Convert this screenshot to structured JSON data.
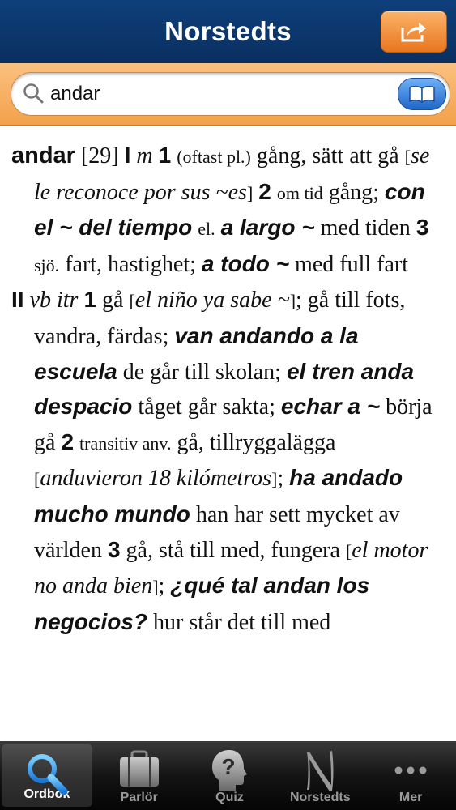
{
  "header": {
    "title": "Norstedts",
    "share_icon": "share-icon"
  },
  "search": {
    "value": "andar",
    "icon": "search-icon",
    "book_icon": "book-icon"
  },
  "entry": {
    "headword": "andar",
    "conj": "[29]",
    "s1": "I",
    "pos1": "m",
    "n1": "1",
    "note1": "(oftast pl.)",
    "t1": "gång, sätt att gå",
    "ex1": "se le reconoce por sus ~es",
    "n2": "2",
    "note2": "om tid",
    "t2": "gång;",
    "ex2a": "con el ~ del tiempo",
    "el": "el.",
    "ex2b": "a largo ~",
    "t3": "med tiden",
    "n3": "3",
    "note3": "sjö.",
    "t4": "fart, hastighet;",
    "ex3": "a todo ~",
    "t5": "med full fart",
    "s2": "II",
    "pos2": "vb itr",
    "m1": "1",
    "t6": "gå",
    "ex4": "el niño ya sabe ~",
    "t7": "; gå till fots, vandra, färdas;",
    "ex5": "van andando a la escuela",
    "t8": "de går till skolan;",
    "ex6": "el tren anda despacio",
    "t9": "tåget går sakta;",
    "ex7": "echar a ~",
    "t10": "börja gå",
    "m2": "2",
    "note4": "transitiv anv.",
    "t11": "gå, tillryggalägga",
    "ex8": "anduvieron 18 kilómetros",
    "ex9": "ha andado mucho mundo",
    "t12": "han har sett mycket av världen",
    "m3": "3",
    "t13": "gå, stå till med, fungera",
    "ex10": "el motor no anda bien",
    "ex11": "¿qué tal andan los negocios?",
    "t14": "hur står det till med"
  },
  "tabs": [
    {
      "label": "Ordbok",
      "icon": "magnifier-icon"
    },
    {
      "label": "Parlör",
      "icon": "suitcase-icon"
    },
    {
      "label": "Quiz",
      "icon": "question-head-icon"
    },
    {
      "label": "Norstedts",
      "icon": "norstedts-n-icon"
    },
    {
      "label": "Mer",
      "icon": "more-dots-icon"
    }
  ]
}
